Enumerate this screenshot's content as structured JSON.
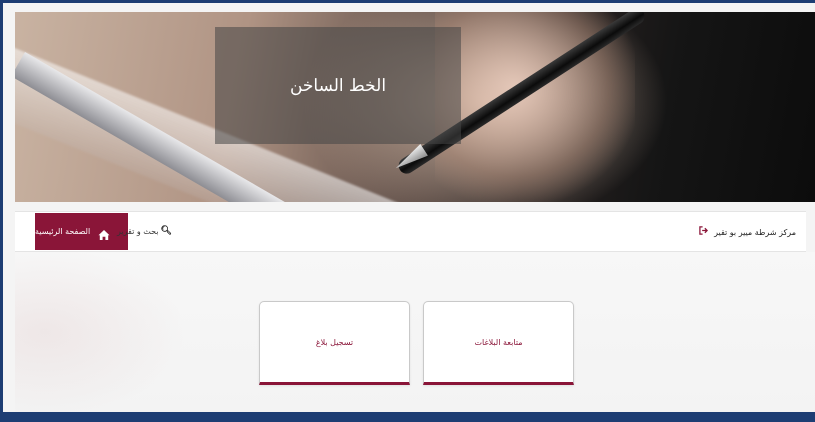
{
  "hero": {
    "title": "الخط الساخن"
  },
  "navbar": {
    "home_label": "الصفحة الرئيسية",
    "home_icon": "home-icon",
    "search_label": "بحث و تقرير",
    "search_icon": "search-icon",
    "station_label": "مركز شرطة ميير بو تقير",
    "logout_icon": "logout-icon"
  },
  "cards": {
    "register_label": "تسجيل بلاغ",
    "follow_label": "متابعة البلاغات"
  },
  "colors": {
    "brand": "#8a1538",
    "frame": "#1d3d73"
  }
}
